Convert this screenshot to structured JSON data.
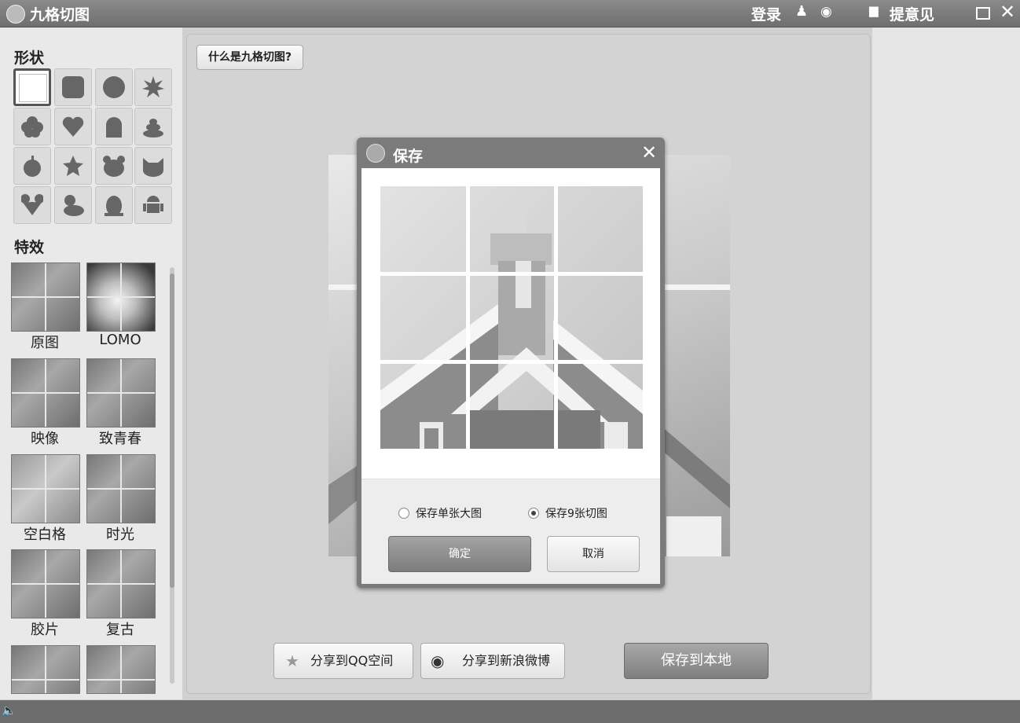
{
  "window": {
    "title": "九格切图",
    "login": "登录",
    "feedback": "提意见"
  },
  "sidebar": {
    "shapes_title": "形状",
    "effects_title": "特效",
    "shapes": [
      "square",
      "rounded-square",
      "circle",
      "burst",
      "flower",
      "heart",
      "tombstone",
      "poop",
      "apple",
      "star",
      "bear",
      "cat",
      "mouse",
      "duck",
      "penguin",
      "android"
    ],
    "effects": [
      "原图",
      "LOMO",
      "映像",
      "致青春",
      "空白格",
      "时光",
      "胶片",
      "复古"
    ]
  },
  "main": {
    "help_button": "什么是九格切图?",
    "share_qq": "分享到QQ空间",
    "share_weibo": "分享到新浪微博",
    "save_local": "保存到本地"
  },
  "dialog": {
    "title": "保存",
    "option_single": "保存单张大图",
    "option_nine": "保存9张切图",
    "selected_option": "nine",
    "confirm": "确定",
    "cancel": "取消"
  },
  "colors": {
    "titlebar": "#7a7a7a",
    "primary_button": "#8f8f8f"
  }
}
